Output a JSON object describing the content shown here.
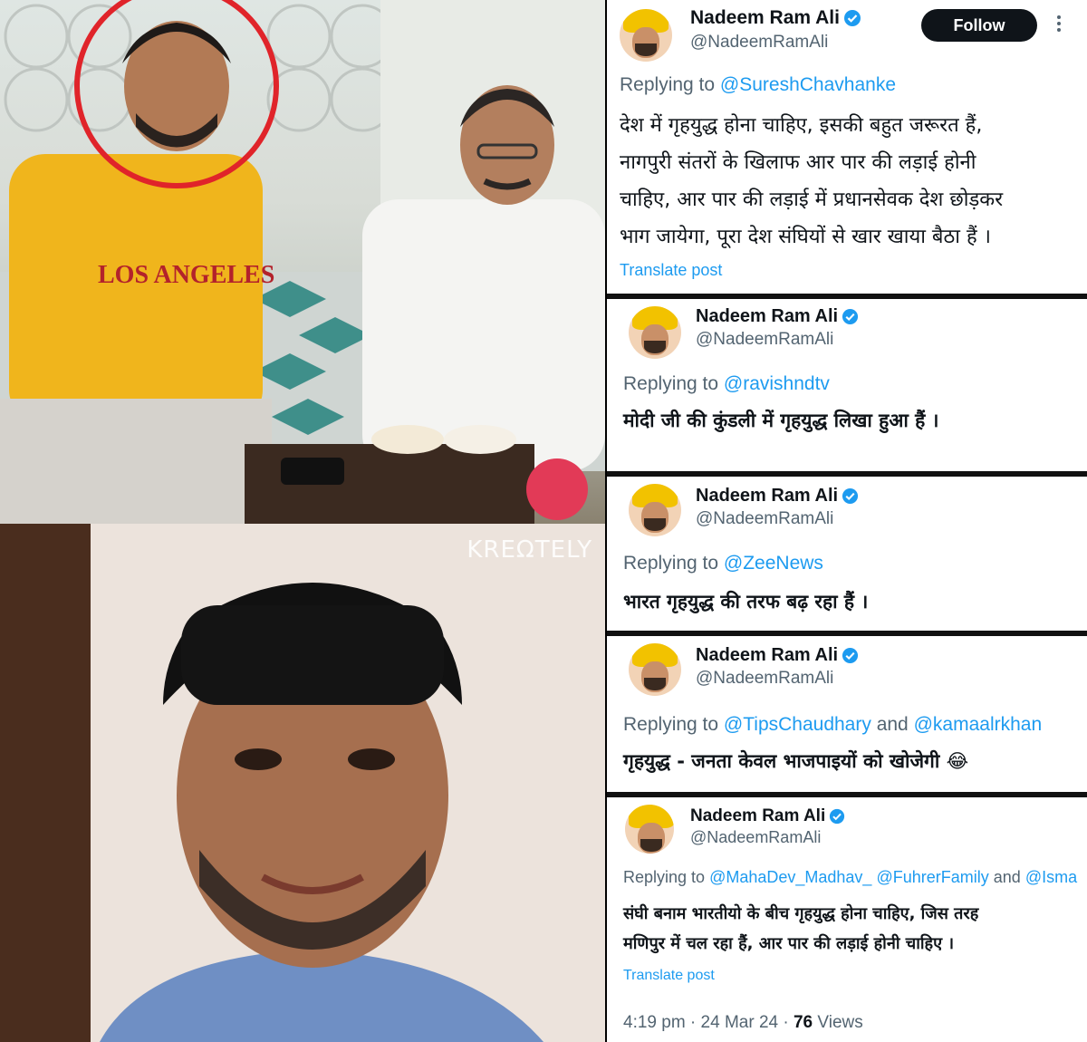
{
  "photos": {
    "top_alt": "",
    "watermark": "KREΩTELY",
    "shirt_text": "LOS ANGELES"
  },
  "author": {
    "name": "Nadeem Ram Ali",
    "handle": "@NadeemRamAli"
  },
  "follow_label": "Follow",
  "translate_label": "Translate post",
  "replying_prefix": "Replying to",
  "tweets": [
    {
      "replying_to": "@SureshChavhanke",
      "lines": [
        "देश में गृहयुद्ध होना चाहिए, इसकी बहुत जरूरत हैं,",
        "नागपुरी संतरों के खिलाफ आर पार की लड़ाई होनी",
        "चाहिए, आर पार की लड़ाई में प्रधानसेवक देश छोड़कर",
        "भाग जायेगा, पूरा देश संघियों से खार खाया बैठा हैं ।"
      ]
    },
    {
      "replying_to": "@ravishndtv",
      "lines": [
        "मोदी जी की कुंडली में गृहयुद्ध लिखा हुआ हैं ।"
      ]
    },
    {
      "replying_to": "@ZeeNews",
      "lines": [
        "भारत गृहयुद्ध की तरफ बढ़ रहा हैं ।"
      ]
    },
    {
      "replying_to": "@TipsChaudhary",
      "and": "and",
      "replying_to_2": "@kamaalrkhan",
      "lines": [
        "गृहयुद्ध - जनता केवल भाजपाइयों को खोजेगी 😂"
      ]
    },
    {
      "replying_to": "@MahaDev_Madhav_",
      "replying_to_2": "@FuhrerFamily",
      "and": "and",
      "replying_to_3": "@Isma",
      "lines": [
        "संघी बनाम भारतीयो के बीच गृहयुद्ध होना चाहिए, जिस तरह",
        "मणिपुर में चल रहा हैं, आर पार की लड़ाई होनी चाहिए ।"
      ],
      "time": "4:19 pm",
      "date": "24 Mar 24",
      "views_count": "76",
      "views_label": "Views"
    }
  ],
  "colors": {
    "link": "#1d9bf0",
    "verified": "#1d9bf0",
    "secondary": "#536471",
    "text": "#0f1419"
  }
}
